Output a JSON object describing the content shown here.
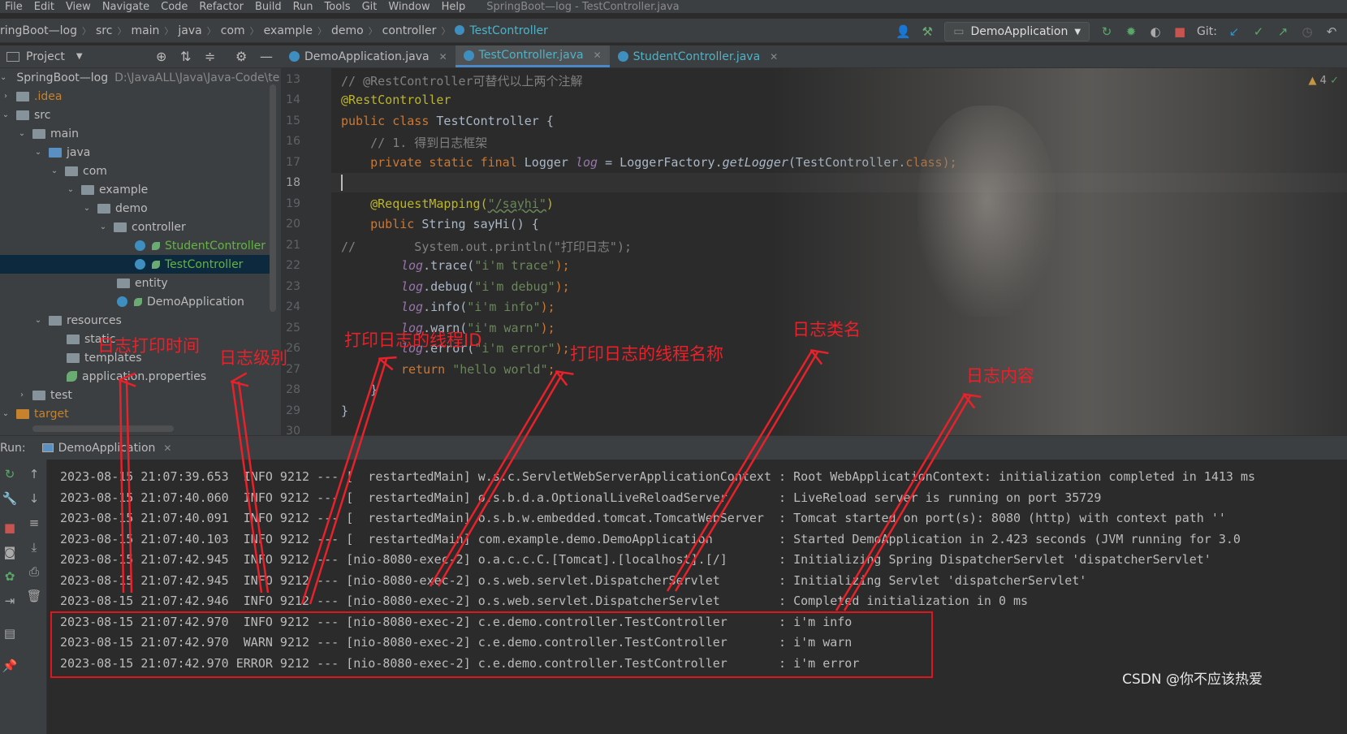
{
  "menubar": {
    "items": [
      "File",
      "Edit",
      "View",
      "Navigate",
      "Code",
      "Refactor",
      "Build",
      "Run",
      "Tools",
      "Git",
      "Window",
      "Help"
    ],
    "window_title": "SpringBoot—log - TestController.java"
  },
  "navbar": {
    "crumbs": [
      "ringBoot—log",
      "src",
      "main",
      "java",
      "com",
      "example",
      "demo",
      "controller"
    ],
    "current_class": "TestController",
    "run_config": "DemoApplication",
    "git_label": "Git:"
  },
  "project": {
    "header_label": "Project",
    "tree": [
      {
        "label": "SpringBoot—log",
        "path": "D:\\JavaALL\\Java\\Java-Code\\te",
        "type": "root"
      },
      {
        "label": ".idea",
        "type": "folder-gray",
        "style": "orange"
      },
      {
        "label": "src",
        "type": "folder-gray"
      },
      {
        "label": "main",
        "type": "folder-gray"
      },
      {
        "label": "java",
        "type": "folder-blue"
      },
      {
        "label": "com",
        "type": "folder-gray"
      },
      {
        "label": "example",
        "type": "folder-gray"
      },
      {
        "label": "demo",
        "type": "folder-gray"
      },
      {
        "label": "controller",
        "type": "folder-gray"
      },
      {
        "label": "StudentController",
        "type": "class",
        "style": "green"
      },
      {
        "label": "TestController",
        "type": "class",
        "style": "green"
      },
      {
        "label": "entity",
        "type": "folder-gray"
      },
      {
        "label": "DemoApplication",
        "type": "class"
      },
      {
        "label": "resources",
        "type": "folder-gray"
      },
      {
        "label": "static",
        "type": "folder-gray"
      },
      {
        "label": "templates",
        "type": "folder-gray"
      },
      {
        "label": "application.properties",
        "type": "props"
      },
      {
        "label": "test",
        "type": "folder-gray"
      },
      {
        "label": "target",
        "type": "folder-orange",
        "style": "orange"
      }
    ]
  },
  "editor": {
    "tabs": [
      {
        "label": "DemoApplication.java"
      },
      {
        "label": "TestController.java"
      },
      {
        "label": "StudentController.java"
      }
    ],
    "warning_count": "4",
    "line_numbers": [
      "13",
      "14",
      "15",
      "16",
      "17",
      "18",
      "19",
      "20",
      "21",
      "22",
      "23",
      "24",
      "25",
      "26",
      "27",
      "28",
      "29",
      "30"
    ],
    "lines": {
      "l13": "// @RestController可替代以上两个注解",
      "l14": "@RestController",
      "l15a": "public class ",
      "l15b": "TestController {",
      "l16": "    // 1. 得到日志框架",
      "l17a": "    private static final ",
      "l17b": "Logger ",
      "l17c": "log",
      "l17d": " = LoggerFactory.",
      "l17e": "getLogger",
      "l17f": "(TestController.",
      "l17g": "class",
      "l17h": ");",
      "l19a": "    @RequestMapping(",
      "l19b": "\"/sayhi\"",
      "l19c": ")",
      "l20a": "    public ",
      "l20b": "String sayHi() {",
      "l21": "//        System.out.println(\"打印日志\");",
      "l22a": "log",
      "l22b": ".trace(",
      "l22c": "\"i'm trace\"",
      "l22d": ");",
      "l23a": "log",
      "l23b": ".debug(",
      "l23c": "\"i'm debug\"",
      "l23d": ");",
      "l24a": "log",
      "l24b": ".info(",
      "l24c": "\"i'm info\"",
      "l24d": ");",
      "l25a": "log",
      "l25b": ".warn(",
      "l25c": "\"i'm warn\"",
      "l25d": ");",
      "l26a": "log",
      "l26b": ".error(",
      "l26c": "\"i'm error\"",
      "l26d": ");",
      "l27a": "return ",
      "l27b": "\"hello world\"",
      "l27c": ";",
      "l28": "}",
      "l29": "}"
    }
  },
  "run": {
    "label": "Run:",
    "tab_label": "DemoApplication",
    "log_lines": [
      "2023-08-15 21:07:39.653  INFO 9212 --- [  restartedMain] w.s.c.ServletWebServerApplicationContext : Root WebApplicationContext: initialization completed in 1413 ms",
      "2023-08-15 21:07:40.060  INFO 9212 --- [  restartedMain] o.s.b.d.a.OptionalLiveReloadServer       : LiveReload server is running on port 35729",
      "2023-08-15 21:07:40.091  INFO 9212 --- [  restartedMain] o.s.b.w.embedded.tomcat.TomcatWebServer  : Tomcat started on port(s): 8080 (http) with context path ''",
      "2023-08-15 21:07:40.103  INFO 9212 --- [  restartedMain] com.example.demo.DemoApplication         : Started DemoApplication in 2.423 seconds (JVM running for 3.0",
      "2023-08-15 21:07:42.945  INFO 9212 --- [nio-8080-exec-2] o.a.c.c.C.[Tomcat].[localhost].[/]       : Initializing Spring DispatcherServlet 'dispatcherServlet'",
      "2023-08-15 21:07:42.945  INFO 9212 --- [nio-8080-exec-2] o.s.web.servlet.DispatcherServlet        : Initializing Servlet 'dispatcherServlet'",
      "2023-08-15 21:07:42.946  INFO 9212 --- [nio-8080-exec-2] o.s.web.servlet.DispatcherServlet        : Completed initialization in 0 ms",
      "2023-08-15 21:07:42.970  INFO 9212 --- [nio-8080-exec-2] c.e.demo.controller.TestController       : i'm info",
      "2023-08-15 21:07:42.970  WARN 9212 --- [nio-8080-exec-2] c.e.demo.controller.TestController       : i'm warn",
      "2023-08-15 21:07:42.970 ERROR 9212 --- [nio-8080-exec-2] c.e.demo.controller.TestController       : i'm error"
    ]
  },
  "annotations": {
    "time": "日志打印时间",
    "level": "日志级别",
    "thread_id": "打印日志的线程ID",
    "thread_name": "打印日志的线程名称",
    "class_name": "日志类名",
    "content": "日志内容"
  },
  "watermark": "CSDN @你不应该热爱",
  "colors": {
    "annotation_red": "#e8212a",
    "active_tab_accent": "#4a88c7",
    "background": "#2b2b2b",
    "panel": "#3c3f41"
  }
}
